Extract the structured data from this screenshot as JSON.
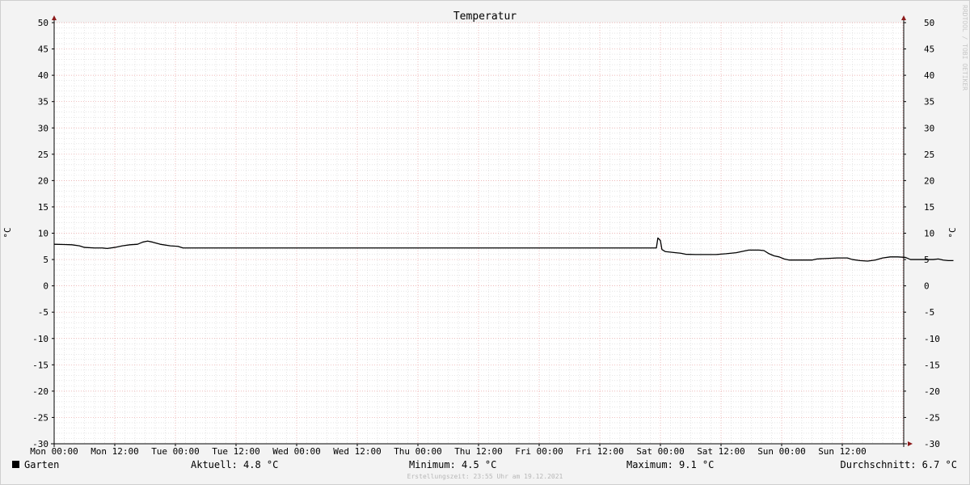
{
  "chart_data": {
    "type": "line",
    "title": "Temperatur",
    "ylabel": "°C",
    "ylim": [
      -30,
      50
    ],
    "y_major_step": 5,
    "y_minor_step": 1,
    "x_ticks": [
      "Mon 00:00",
      "Mon 12:00",
      "Tue 00:00",
      "Tue 12:00",
      "Wed 00:00",
      "Wed 12:00",
      "Thu 00:00",
      "Thu 12:00",
      "Fri 00:00",
      "Fri 12:00",
      "Sat 00:00",
      "Sat 12:00",
      "Sun 00:00",
      "Sun 12:00"
    ],
    "x_unit": "hours since Mon 00:00",
    "xlim": [
      0,
      168
    ],
    "x_major_step": 12,
    "x_minor_step": 2,
    "grid": true,
    "colors": {
      "plot_bg": "#ffffff",
      "major_grid": "#e8a0a0",
      "minor_grid": "#d6d6d6",
      "axis": "#000000",
      "arrow": "#8b1a1a",
      "line": "#000000"
    },
    "series": [
      {
        "name": "Garten",
        "color": "#000000",
        "points": [
          [
            0,
            7.9
          ],
          [
            2,
            7.85
          ],
          [
            3.5,
            7.8
          ],
          [
            5,
            7.6
          ],
          [
            6,
            7.3
          ],
          [
            8,
            7.2
          ],
          [
            9.5,
            7.2
          ],
          [
            10.5,
            7.1
          ],
          [
            12,
            7.3
          ],
          [
            13.5,
            7.6
          ],
          [
            15,
            7.8
          ],
          [
            16.5,
            7.9
          ],
          [
            17.5,
            8.3
          ],
          [
            18.5,
            8.5
          ],
          [
            19.5,
            8.3
          ],
          [
            21,
            7.9
          ],
          [
            23,
            7.6
          ],
          [
            24.5,
            7.5
          ],
          [
            25.5,
            7.2
          ],
          [
            40,
            7.2
          ],
          [
            60,
            7.2
          ],
          [
            80,
            7.2
          ],
          [
            100,
            7.2
          ],
          [
            119.2,
            7.2
          ],
          [
            119.5,
            9.1
          ],
          [
            120,
            8.6
          ],
          [
            120.3,
            6.9
          ],
          [
            121,
            6.5
          ],
          [
            123,
            6.3
          ],
          [
            124,
            6.2
          ],
          [
            125,
            6.0
          ],
          [
            127,
            5.95
          ],
          [
            131,
            5.95
          ],
          [
            133,
            6.1
          ],
          [
            135,
            6.3
          ],
          [
            136.5,
            6.6
          ],
          [
            137.5,
            6.8
          ],
          [
            139.5,
            6.8
          ],
          [
            140.5,
            6.7
          ],
          [
            141.5,
            6.1
          ],
          [
            142.5,
            5.7
          ],
          [
            143.5,
            5.5
          ],
          [
            144.5,
            5.1
          ],
          [
            145.5,
            4.9
          ],
          [
            148,
            4.9
          ],
          [
            150,
            4.9
          ],
          [
            151,
            5.1
          ],
          [
            153,
            5.2
          ],
          [
            155,
            5.3
          ],
          [
            157,
            5.3
          ],
          [
            158,
            5.0
          ],
          [
            159.5,
            4.8
          ],
          [
            161,
            4.7
          ],
          [
            162.5,
            4.9
          ],
          [
            164,
            5.3
          ],
          [
            165.5,
            5.5
          ],
          [
            167,
            5.5
          ],
          [
            168.5,
            5.4
          ],
          [
            169.5,
            5.0
          ],
          [
            172,
            5.0
          ],
          [
            174,
            5.0
          ],
          [
            175,
            5.1
          ],
          [
            176,
            4.9
          ],
          [
            177,
            4.8
          ],
          [
            178,
            4.8
          ]
        ]
      }
    ]
  },
  "legend": {
    "series_name": "Garten",
    "current": "Aktuell: 4.8 °C",
    "minimum": "Minimum: 4.5 °C",
    "maximum": "Maximum: 9.1 °C",
    "average": "Durchschnitt: 6.7 °C"
  },
  "watermark": "RRDTOOL / TOBI OETIKER",
  "footer": "Erstellungszeit: 23:55 Uhr am 19.12.2021"
}
